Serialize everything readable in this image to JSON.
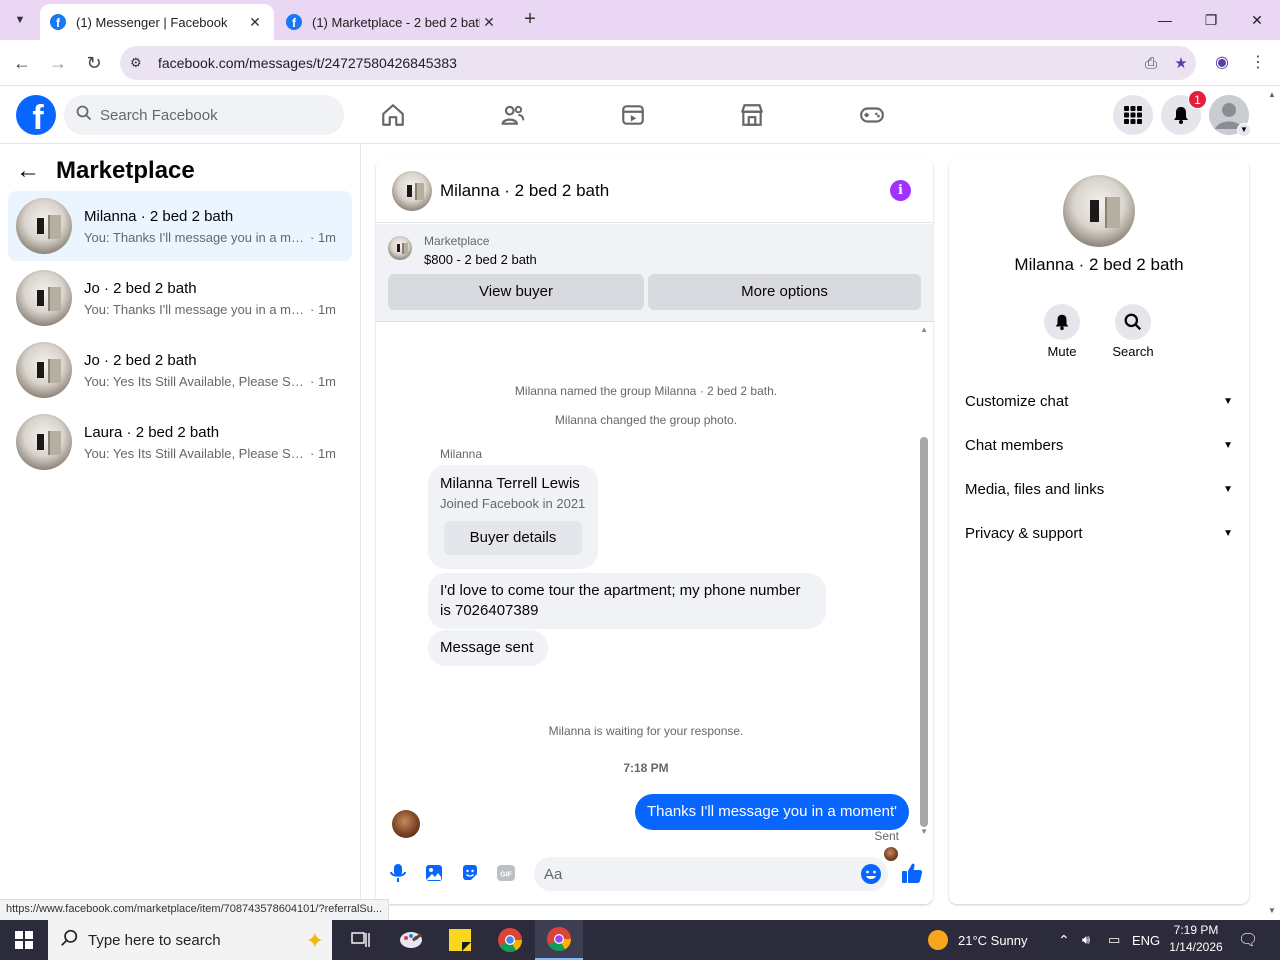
{
  "browser": {
    "tabs": [
      {
        "title": "(1) Messenger | Facebook",
        "active": true
      },
      {
        "title": "(1) Marketplace - 2 bed 2 bath |",
        "active": false
      }
    ],
    "url": "facebook.com/messages/t/24727580426845383"
  },
  "fb_header": {
    "search_placeholder": "Search Facebook",
    "notification_count": "1",
    "accent_color": "#0866ff"
  },
  "sidebar": {
    "title": "Marketplace",
    "conversations": [
      {
        "name": "Milanna · 2 bed 2 bath",
        "snippet": "You: Thanks I'll message you in a mo...",
        "time": "· 1m",
        "selected": true
      },
      {
        "name": "Jo · 2 bed 2 bath",
        "snippet": "You: Thanks I'll message you in a mo...",
        "time": "· 1m",
        "selected": false
      },
      {
        "name": "Jo · 2 bed 2 bath",
        "snippet": "You: Yes Its Still Available, Please Sen...",
        "time": "· 1m",
        "selected": false
      },
      {
        "name": "Laura · 2 bed 2 bath",
        "snippet": "You: Yes Its Still Available, Please Sen...",
        "time": "· 1m",
        "selected": false
      }
    ]
  },
  "chat": {
    "title": "Milanna · 2 bed 2 bath",
    "listing": {
      "category": "Marketplace",
      "price_line": "$800 - 2 bed 2 bath",
      "view_buyer": "View buyer",
      "more_options": "More options"
    },
    "system_messages": {
      "named": "Milanna named the group Milanna · 2 bed 2 bath.",
      "photo": "Milanna changed the group photo.",
      "waiting": "Milanna is waiting for your response."
    },
    "sender_label": "Milanna",
    "profile_card": {
      "name": "Milanna Terrell Lewis",
      "joined": "Joined Facebook in 2021",
      "button": "Buyer details"
    },
    "incoming": [
      "I'd love to come tour the apartment; my phone number is 7026407389",
      "Message sent"
    ],
    "timestamp": "7:18 PM",
    "outgoing": "Thanks I'll message you in a moment'",
    "sent_status": "Sent",
    "composer_placeholder": "Aa"
  },
  "info_panel": {
    "name": "Milanna · 2 bed 2 bath",
    "actions": [
      {
        "label": "Mute",
        "icon": "bell-icon"
      },
      {
        "label": "Search",
        "icon": "search-icon"
      }
    ],
    "sections": [
      "Customize chat",
      "Chat members",
      "Media, files and links",
      "Privacy & support"
    ]
  },
  "status_url": "https://www.facebook.com/marketplace/item/708743578604101/?referralSu...",
  "taskbar": {
    "search_placeholder": "Type here to search",
    "weather": "21°C  Sunny",
    "language": "ENG",
    "time": "7:19 PM",
    "date": "1/14/2026"
  }
}
